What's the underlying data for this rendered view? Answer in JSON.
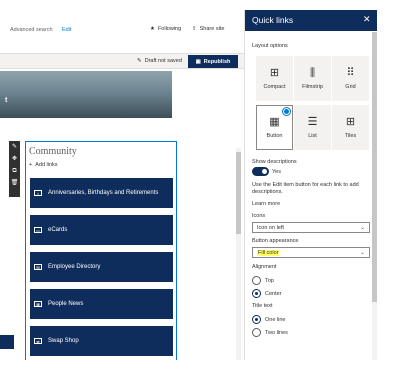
{
  "topbar": {
    "advanced_search": "Advanced search",
    "edit": "Edit",
    "following": "Following",
    "share_site": "Share site"
  },
  "cmdbar": {
    "draft_status": "Draft not saved",
    "republish": "Republish"
  },
  "hero": {
    "title": "t"
  },
  "webpart": {
    "title": "Community",
    "add_links": "Add links",
    "links": [
      {
        "label": "Anniversaries, Birthdays and Retirements",
        "icon": "cake-icon"
      },
      {
        "label": "eCards",
        "icon": "card-icon"
      },
      {
        "label": "Employee Directory",
        "icon": "directory-icon"
      },
      {
        "label": "People News",
        "icon": "news-icon"
      },
      {
        "label": "Swap Shop",
        "icon": "shop-icon"
      }
    ]
  },
  "pane": {
    "title": "Quick links",
    "layout_options_label": "Layout options",
    "layouts": [
      {
        "label": "Compact",
        "icon": "compact-layout-icon",
        "selected": false
      },
      {
        "label": "Filmstrip",
        "icon": "filmstrip-layout-icon",
        "selected": false
      },
      {
        "label": "Grid",
        "icon": "grid-layout-icon",
        "selected": false
      },
      {
        "label": "Button",
        "icon": "button-layout-icon",
        "selected": true
      },
      {
        "label": "List",
        "icon": "list-layout-icon",
        "selected": false
      },
      {
        "label": "Tiles",
        "icon": "tiles-layout-icon",
        "selected": false
      }
    ],
    "show_descriptions_label": "Show descriptions",
    "show_descriptions_value": "Yes",
    "help_text": "Use the Edit item button for each link to add descriptions.",
    "learn_more": "Learn more",
    "icons_label": "Icons",
    "icons_value": "Icon on left",
    "button_appearance_label": "Button appearance",
    "button_appearance_value": "Fill color",
    "alignment_label": "Alignment",
    "alignment_options": [
      {
        "label": "Top",
        "selected": false
      },
      {
        "label": "Center",
        "selected": true
      }
    ],
    "title_text_label": "Title text",
    "title_text_options": [
      {
        "label": "One line",
        "selected": true
      },
      {
        "label": "Two lines",
        "selected": false
      }
    ]
  },
  "colors": {
    "brand_navy": "#0f2d5c",
    "accent_blue": "#0078d4",
    "highlight": "#ffff66"
  }
}
